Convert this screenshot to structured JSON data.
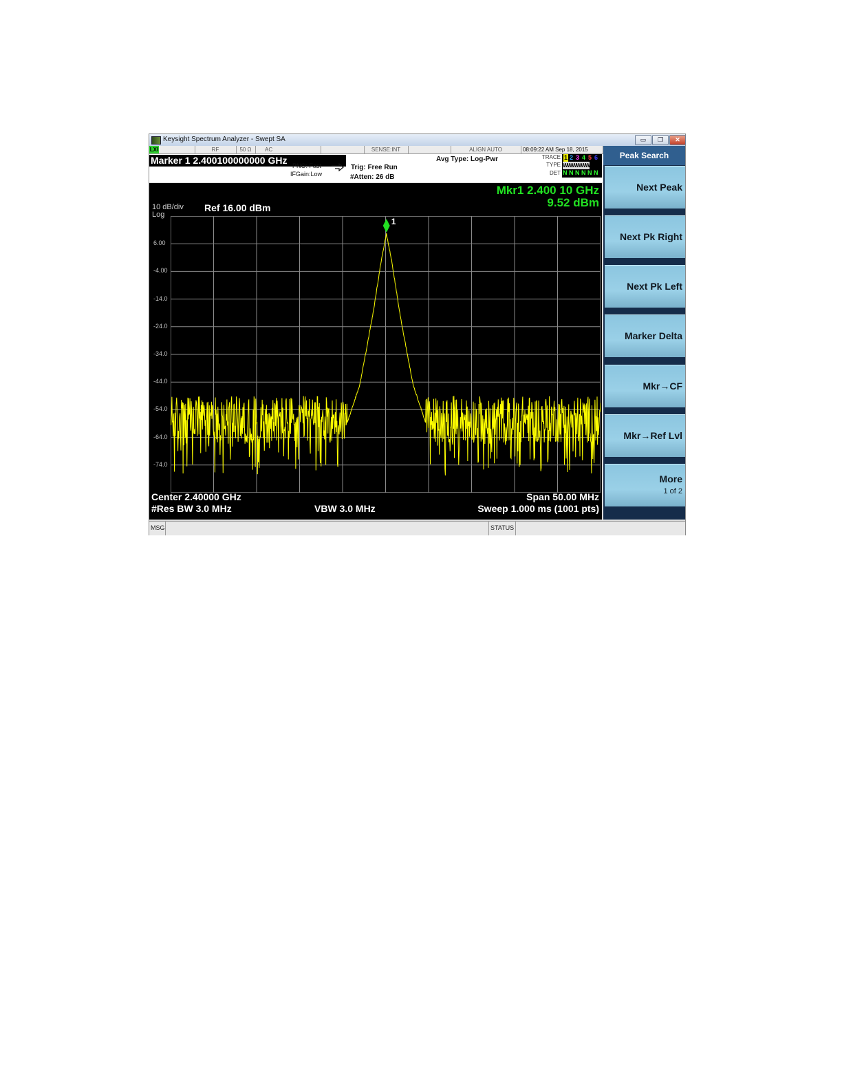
{
  "window": {
    "title": "Keysight Spectrum Analyzer - Swept SA",
    "controls": {
      "minimize": "▭",
      "maximize": "❐",
      "close": "✕"
    }
  },
  "status_bar": {
    "lxi": "LXI",
    "rf": "RF",
    "impedance": "50 Ω",
    "coupling": "AC",
    "sense": "SENSE:INT",
    "align": "ALIGN AUTO",
    "datetime": "08:09:22 AM Sep 18, 2015"
  },
  "header": {
    "marker_freq": "Marker 1 2.400100000000 GHz",
    "pno": "PNO: Fast",
    "ifgain": "IFGain:Low",
    "trig": "Trig: Free Run",
    "atten": "#Atten: 26 dB",
    "avg_type": "Avg Type: Log-Pwr",
    "trace_label": "TRACE",
    "type_label": "TYPE",
    "det_label": "DET",
    "trace_numbers": [
      "1",
      "2",
      "3",
      "4",
      "5",
      "6"
    ],
    "trace_type": "WWWWWW",
    "trace_det": "N N N N N N"
  },
  "screen": {
    "scale": "10 dB/div",
    "log": "Log",
    "ref_level": "Ref 16.00 dBm",
    "marker_readout_freq": "Mkr1 2.400 10 GHz",
    "marker_readout_amp": "9.52 dBm",
    "marker_label": "1",
    "y_ticks": [
      "6.00",
      "-4.00",
      "-14.0",
      "-24.0",
      "-34.0",
      "-44.0",
      "-54.0",
      "-64.0",
      "-74.0"
    ],
    "center": "Center 2.40000 GHz",
    "res_bw": "#Res BW 3.0 MHz",
    "vbw": "VBW 3.0 MHz",
    "span": "Span 50.00 MHz",
    "sweep": "Sweep  1.000 ms (1001 pts)"
  },
  "softkeys": {
    "menu_title": "Peak Search",
    "keys": [
      {
        "label": "Next Peak"
      },
      {
        "label": "Next Pk Right"
      },
      {
        "label": "Next Pk Left"
      },
      {
        "label": "Marker Delta"
      },
      {
        "label": "Mkr→CF"
      },
      {
        "label": "Mkr→Ref Lvl"
      },
      {
        "label": "More",
        "sub": "1 of 2"
      }
    ]
  },
  "message_bar": {
    "msg": "MSG",
    "status": "STATUS"
  },
  "colors": {
    "trace": "#ffff00",
    "marker": "#22e022",
    "grid": "#8a8a8a",
    "softkey": "#9ad0e7"
  },
  "chart_data": {
    "type": "line",
    "title": "",
    "xlabel": "",
    "ylabel": "",
    "x_center_ghz": 2.4,
    "x_span_mhz": 50,
    "x_range_ghz": [
      2.375,
      2.425
    ],
    "ylim": [
      -84,
      16
    ],
    "y_units": "dBm",
    "grid": true,
    "points": 1001,
    "series": [
      {
        "x_ghz": [
          2.375,
          2.3875,
          2.3955,
          2.397,
          2.3985,
          2.3995,
          2.4001,
          2.4007,
          2.4017,
          2.4032,
          2.4047,
          2.4125,
          2.425
        ],
        "y_dbm": [
          -59,
          -59,
          -59,
          -45,
          -20,
          0,
          9.52,
          0,
          -20,
          -45,
          -59,
          -59,
          -59
        ]
      }
    ],
    "noise_floor_dbm": {
      "max": -51,
      "typical": -60,
      "min": -78
    },
    "marker": {
      "label": "1",
      "x_ghz": 2.4001,
      "y_dbm": 9.52
    }
  }
}
